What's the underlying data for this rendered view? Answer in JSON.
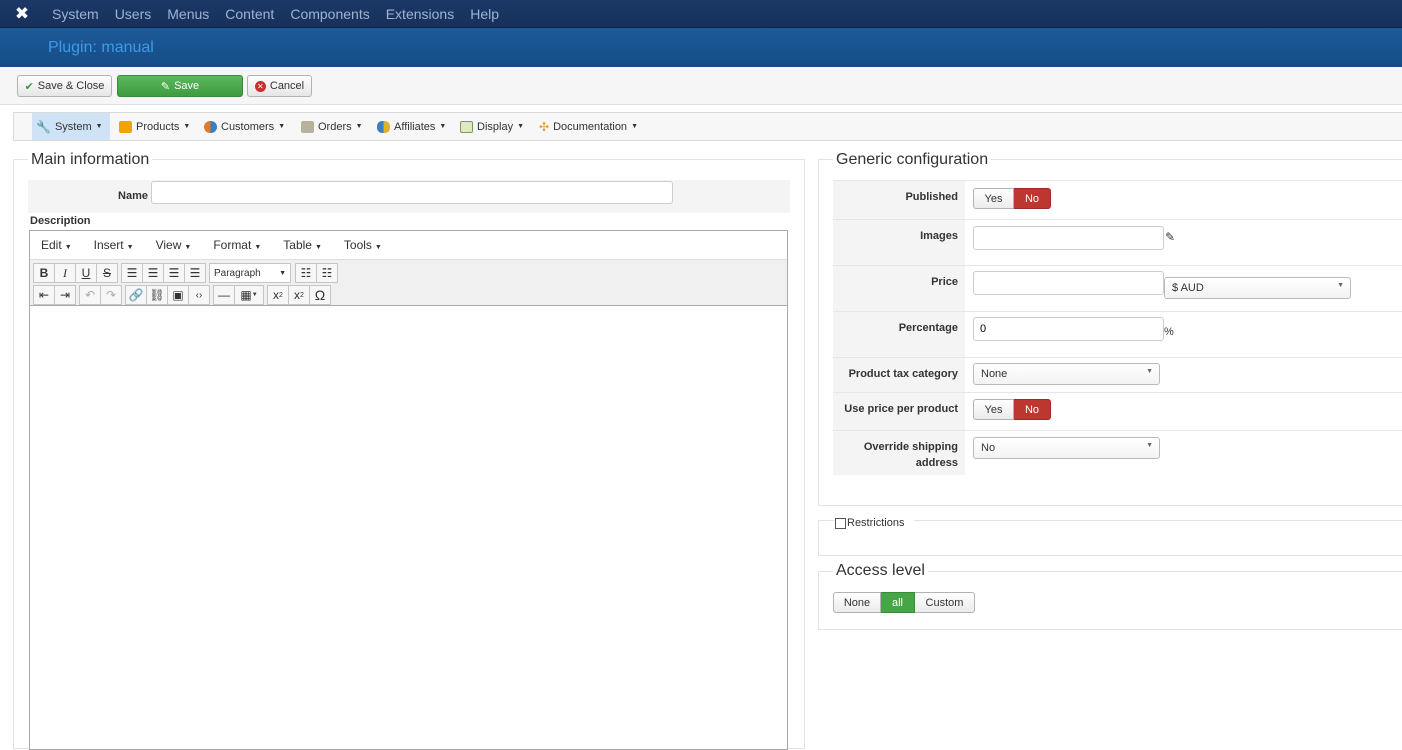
{
  "topnav": {
    "items": [
      "System",
      "Users",
      "Menus",
      "Content",
      "Components",
      "Extensions",
      "Help"
    ]
  },
  "subhead": {
    "title": "Plugin: manual"
  },
  "toolbar": {
    "save_close": "Save & Close",
    "save": "Save",
    "cancel": "Cancel"
  },
  "hikamenu": {
    "items": [
      "System",
      "Products",
      "Customers",
      "Orders",
      "Affiliates",
      "Display",
      "Documentation"
    ]
  },
  "main_info": {
    "legend": "Main information",
    "name_label": "Name",
    "name_value": "",
    "description_label": "Description",
    "editor_menus": [
      "Edit",
      "Insert",
      "View",
      "Format",
      "Table",
      "Tools"
    ],
    "paragraph_select": "Paragraph"
  },
  "generic": {
    "legend": "Generic configuration",
    "published_label": "Published",
    "images_label": "Images",
    "price_label": "Price",
    "price_value": "",
    "currency": "$ AUD",
    "percentage_label": "Percentage",
    "percentage_value": "0",
    "percent_sign": "%",
    "tax_label": "Product tax category",
    "tax_value": "None",
    "use_price_label": "Use price per product",
    "override_label": "Override shipping address",
    "override_value": "No",
    "yes": "Yes",
    "no": "No"
  },
  "restrictions": {
    "label": "Restrictions"
  },
  "access": {
    "legend": "Access level",
    "none": "None",
    "all": "all",
    "custom": "Custom"
  },
  "colors": {
    "red": "#bd362f",
    "green": "#46a546",
    "navy": "#1a3867",
    "blue": "#1d5a9a"
  }
}
